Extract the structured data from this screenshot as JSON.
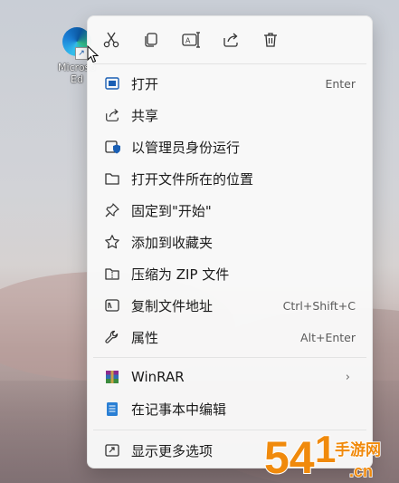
{
  "desktop": {
    "icon_label_line1": "Microso",
    "icon_label_line2": "Ed",
    "icon": "edge-shortcut-icon"
  },
  "toolbar": {
    "cut": "cut-icon",
    "copy": "copy-icon",
    "rename": "rename-icon",
    "share": "share-icon",
    "delete": "delete-icon"
  },
  "menu": {
    "items": [
      {
        "label": "打开",
        "shortcut": "Enter",
        "icon": "open-icon"
      },
      {
        "label": "共享",
        "shortcut": "",
        "icon": "share-icon"
      },
      {
        "label": "以管理员身份运行",
        "shortcut": "",
        "icon": "run-as-admin-icon"
      },
      {
        "label": "打开文件所在的位置",
        "shortcut": "",
        "icon": "folder-icon"
      },
      {
        "label": "固定到\"开始\"",
        "shortcut": "",
        "icon": "pin-icon"
      },
      {
        "label": "添加到收藏夹",
        "shortcut": "",
        "icon": "star-icon"
      },
      {
        "label": "压缩为 ZIP 文件",
        "shortcut": "",
        "icon": "zip-icon"
      },
      {
        "label": "复制文件地址",
        "shortcut": "Ctrl+Shift+C",
        "icon": "copy-path-icon"
      },
      {
        "label": "属性",
        "shortcut": "Alt+Enter",
        "icon": "wrench-icon"
      },
      {
        "label": "WinRAR",
        "shortcut": "",
        "icon": "winrar-icon"
      },
      {
        "label": "在记事本中编辑",
        "shortcut": "",
        "icon": "notepad-icon"
      },
      {
        "label": "显示更多选项",
        "shortcut": "",
        "icon": "more-options-icon"
      }
    ],
    "submenu_arrow": "›"
  },
  "watermark": {
    "text_main": "54",
    "text_side1": "手游网",
    "text_side2": ".cn"
  },
  "colors": {
    "accent": "#1a5fb4",
    "menu_bg": "#f9f9f9",
    "text": "#1b1b1b",
    "watermark": "#f08a0c"
  }
}
